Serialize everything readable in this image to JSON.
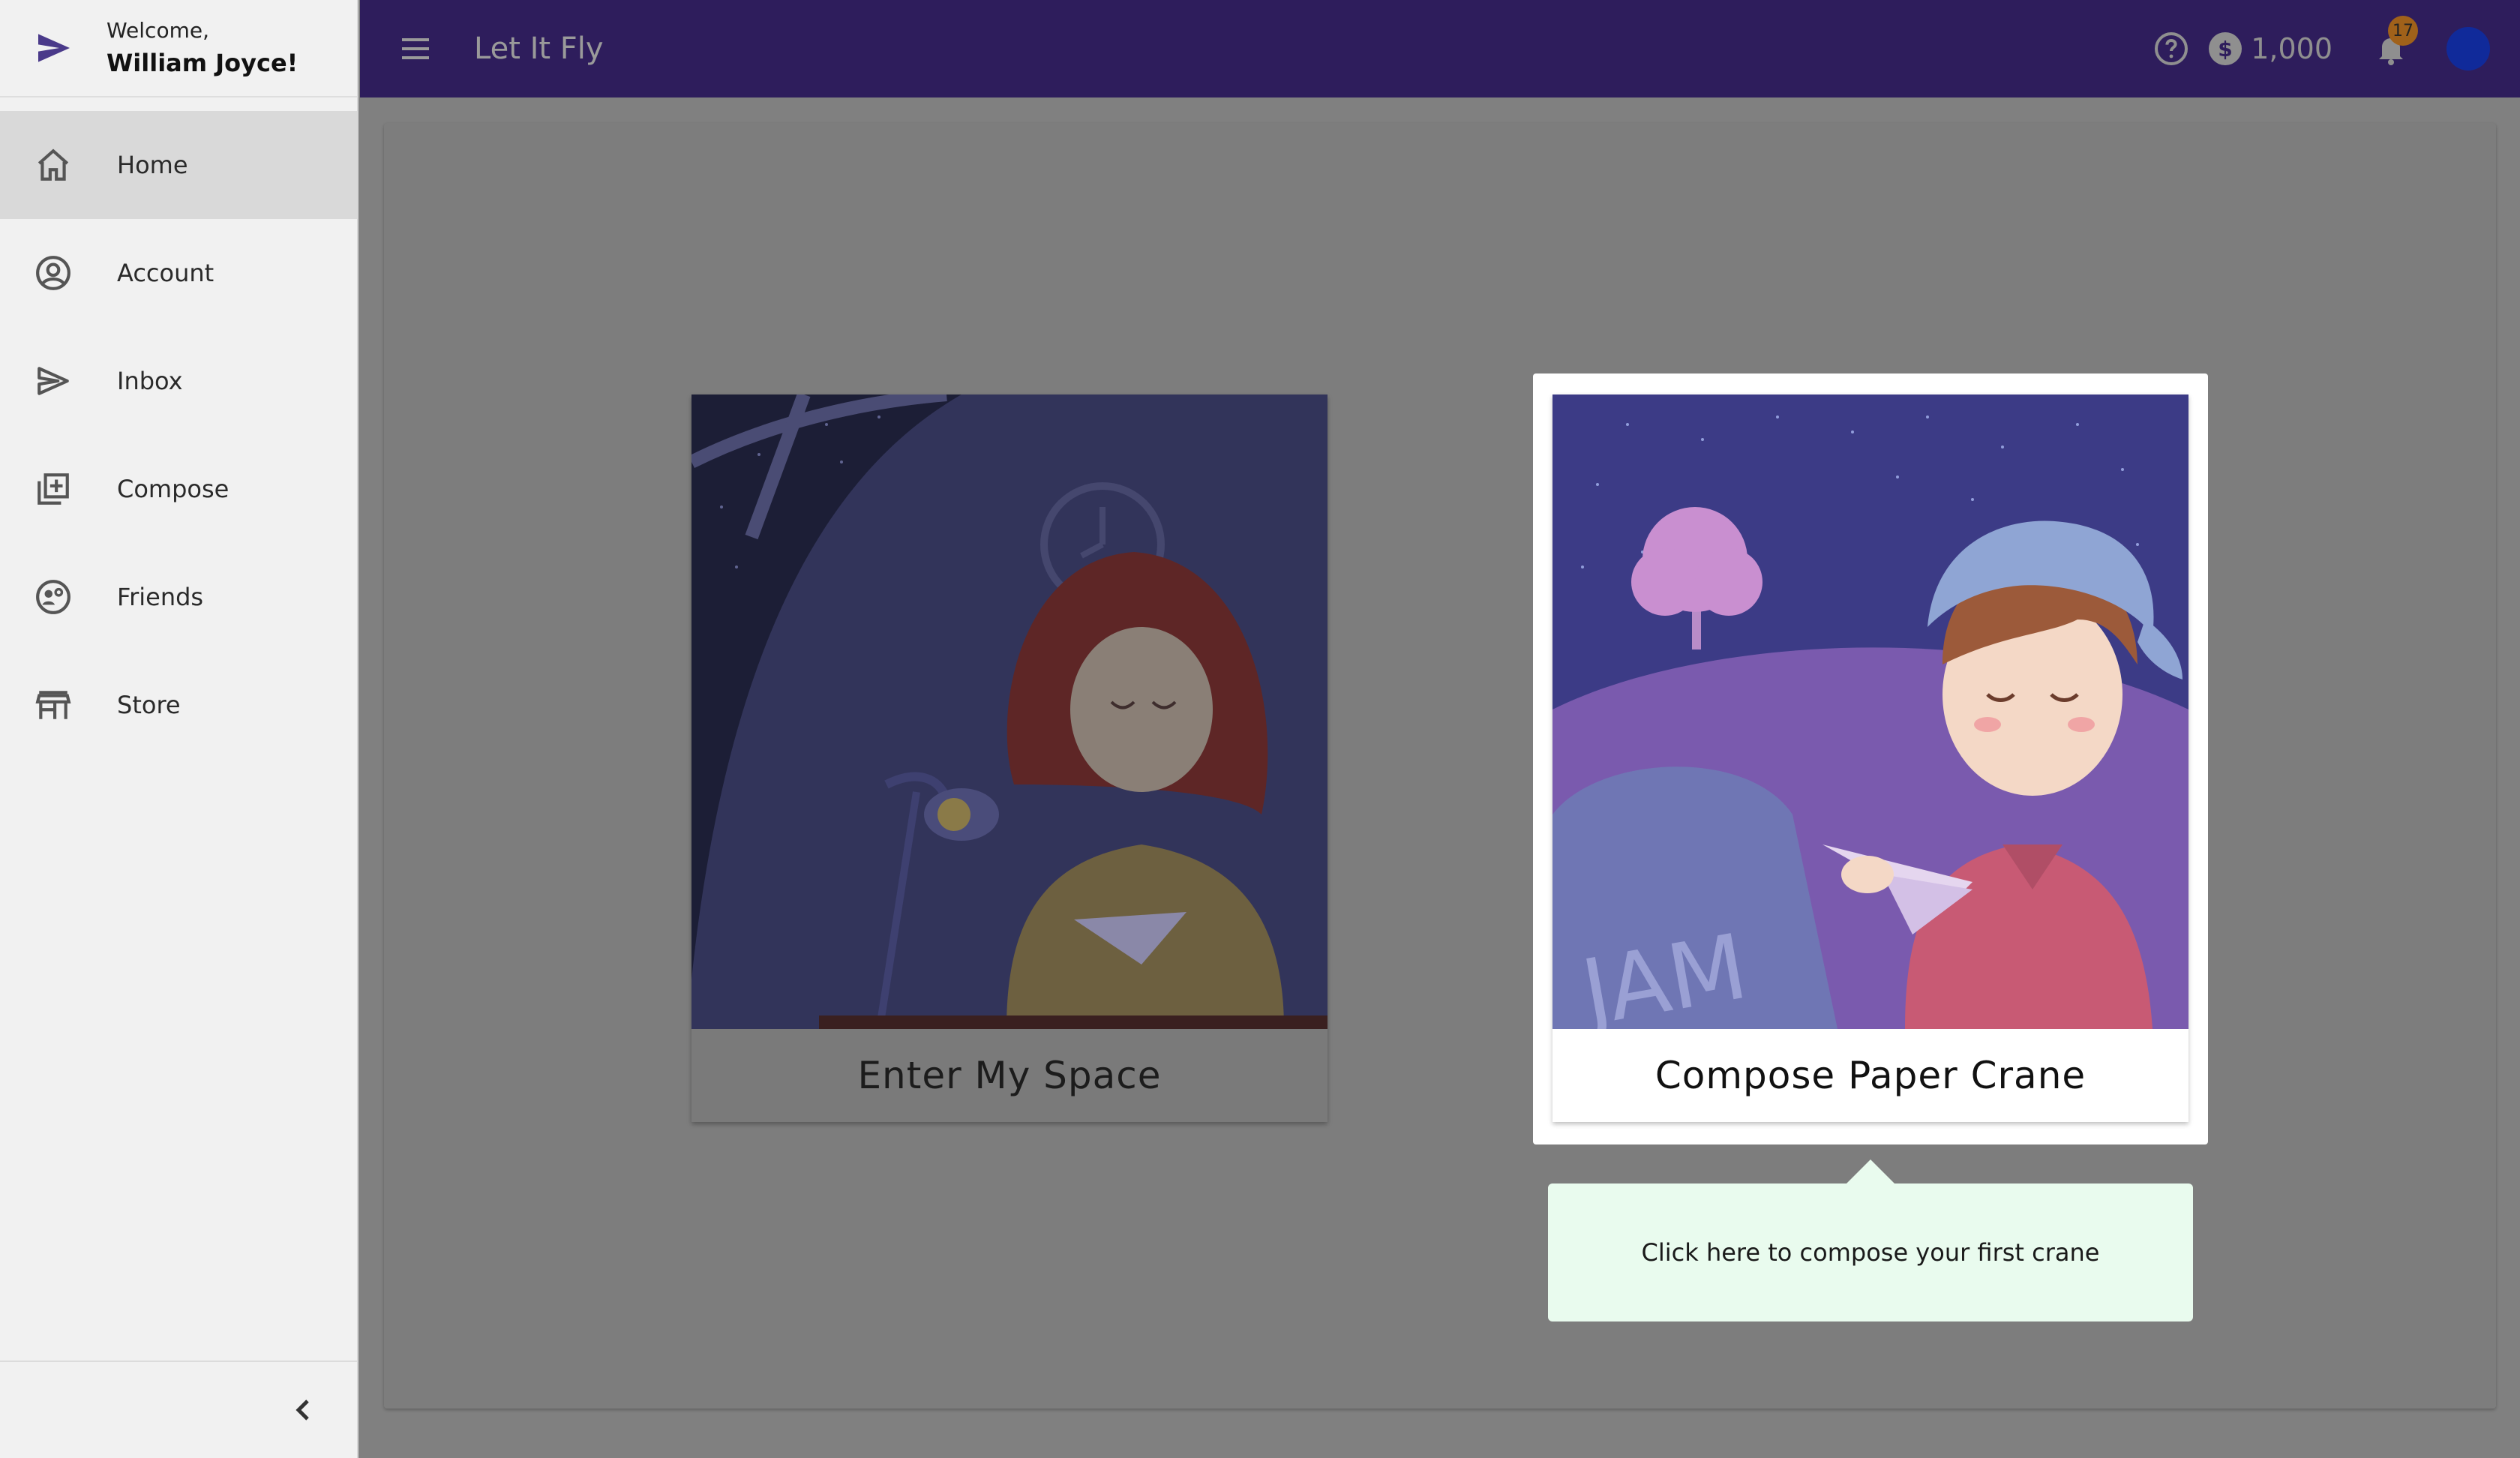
{
  "sidebar": {
    "welcome_line": "Welcome,",
    "user_name": "William Joyce!",
    "items": [
      {
        "label": "Home",
        "icon": "home-icon",
        "active": true
      },
      {
        "label": "Account",
        "icon": "account-circle-icon",
        "active": false
      },
      {
        "label": "Inbox",
        "icon": "send-icon",
        "active": false
      },
      {
        "label": "Compose",
        "icon": "library-add-icon",
        "active": false
      },
      {
        "label": "Friends",
        "icon": "friends-icon",
        "active": false
      },
      {
        "label": "Store",
        "icon": "store-icon",
        "active": false
      }
    ],
    "collapse_icon": "chevron-left-icon"
  },
  "topbar": {
    "title": "Let It Fly",
    "balance": "1,000",
    "notification_count": "17",
    "background_color": "#2e1d5c"
  },
  "main": {
    "cards": [
      {
        "label": "Enter My Space",
        "image": "girl-at-desk-illustration",
        "highlighted": false
      },
      {
        "label": "Compose Paper Crane",
        "image": "boy-with-paper-crane-illustration",
        "highlighted": true
      }
    ],
    "tooltip": "Click here to compose your first crane"
  }
}
